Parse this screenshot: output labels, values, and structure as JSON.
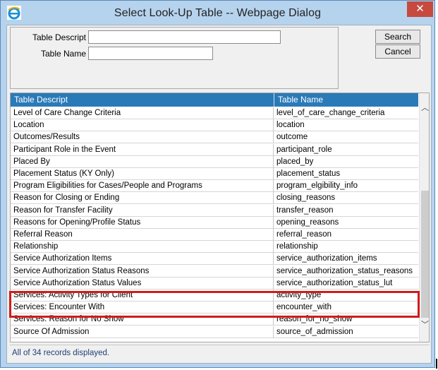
{
  "window": {
    "title": "Select Look-Up Table -- Webpage Dialog",
    "close_label": "✕",
    "icon": "ie-icon"
  },
  "filter": {
    "table_descript_label": "Table Descript",
    "table_descript_value": "",
    "table_name_label": "Table Name",
    "table_name_value": ""
  },
  "buttons": {
    "search": "Search",
    "cancel": "Cancel"
  },
  "grid": {
    "headers": [
      "Table Descript",
      "Table Name"
    ],
    "rows": [
      [
        "Level of Care Change Criteria",
        "level_of_care_change_criteria"
      ],
      [
        "Location",
        "location"
      ],
      [
        "Outcomes/Results",
        "outcome"
      ],
      [
        "Participant Role in the Event",
        "participant_role"
      ],
      [
        "Placed By",
        "placed_by"
      ],
      [
        "Placement Status (KY Only)",
        "placement_status"
      ],
      [
        "Program Eligibilities for Cases/People and Programs",
        "program_elgibility_info"
      ],
      [
        "Reason for Closing or Ending",
        "closing_reasons"
      ],
      [
        "Reason for Transfer Facility",
        "transfer_reason"
      ],
      [
        "Reasons for Opening/Profile Status",
        "opening_reasons"
      ],
      [
        "Referral Reason",
        "referral_reason"
      ],
      [
        "Relationship",
        "relationship"
      ],
      [
        "Service Authorization Items",
        "service_authorization_items"
      ],
      [
        "Service Authorization Status Reasons",
        "service_authorization_status_reasons"
      ],
      [
        "Service Authorization Status Values",
        "service_authorization_status_lut"
      ],
      [
        "Services: Activity Types for Client",
        "activity_type"
      ],
      [
        "Services: Encounter With",
        "encounter_with"
      ],
      [
        "Services: Reason for No Show",
        "reason_for_no_show"
      ],
      [
        "Source Of Admission",
        "source_of_admission"
      ]
    ]
  },
  "status_text": "All of 34 records displayed.",
  "colors": {
    "header_bg": "#2a7ab8",
    "highlight": "#d11b1b",
    "close_bg": "#c74a3f"
  }
}
